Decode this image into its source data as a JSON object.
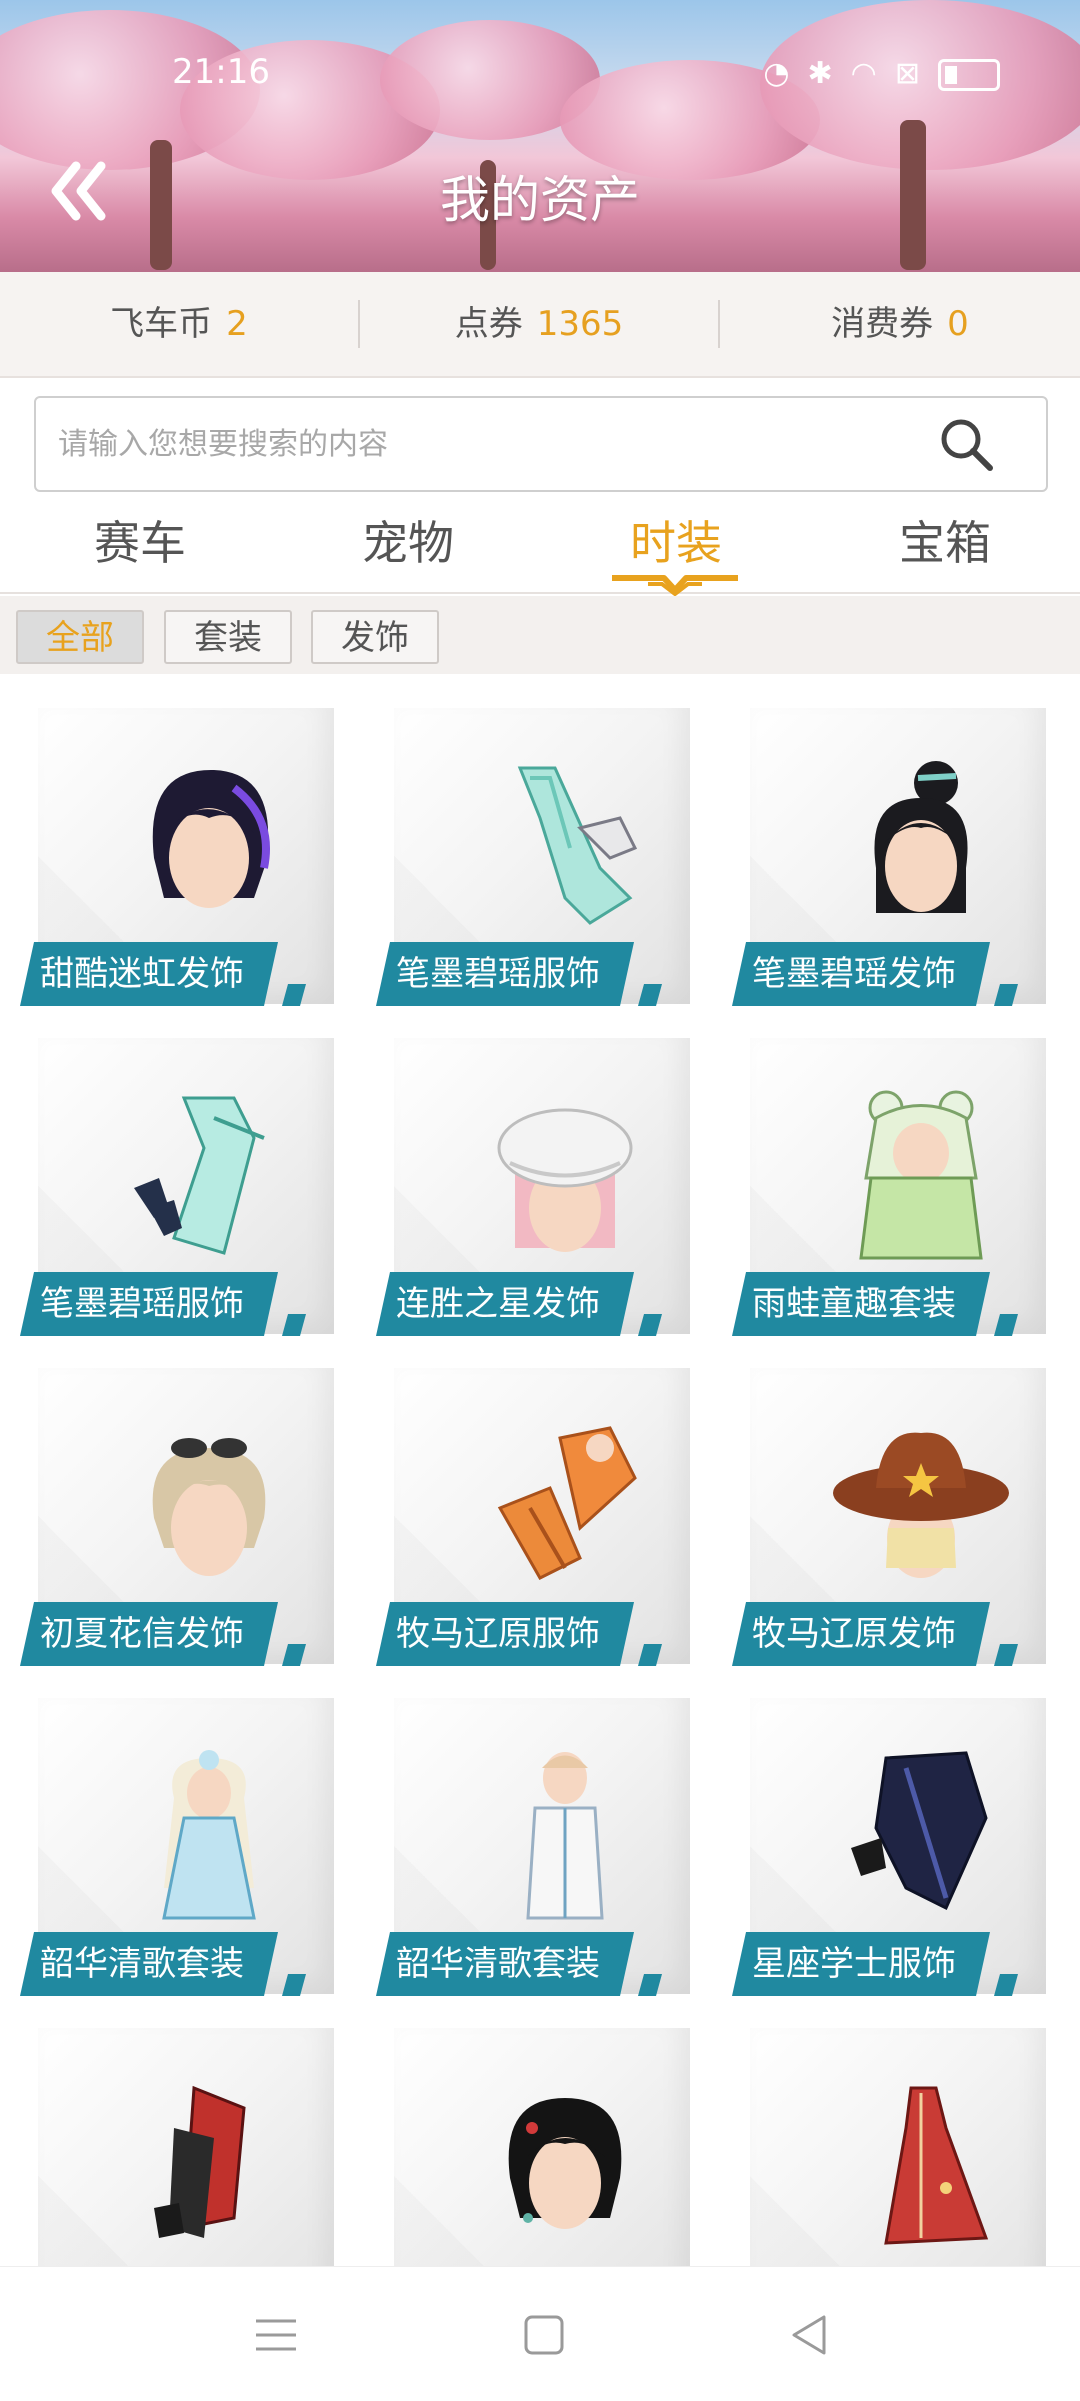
{
  "status_bar": {
    "time": "21:16"
  },
  "header": {
    "title": "我的资产"
  },
  "balances": [
    {
      "label": "飞车币",
      "value": "2"
    },
    {
      "label": "点券",
      "value": "1365"
    },
    {
      "label": "消费券",
      "value": "0"
    }
  ],
  "search": {
    "placeholder": "请输入您想要搜索的内容"
  },
  "tabs": [
    {
      "label": "赛车"
    },
    {
      "label": "宠物"
    },
    {
      "label": "时装",
      "active": true
    },
    {
      "label": "宝箱"
    }
  ],
  "filters": [
    {
      "label": "全部",
      "active": true
    },
    {
      "label": "套装"
    },
    {
      "label": "发饰"
    }
  ],
  "items": [
    {
      "name": "甜酷迷虹发饰",
      "icon": "purple-hair-icon"
    },
    {
      "name": "笔墨碧瑶服饰",
      "icon": "cyan-gown-icon"
    },
    {
      "name": "笔墨碧瑶发饰",
      "icon": "black-updo-hair-icon"
    },
    {
      "name": "笔墨碧瑶服饰",
      "icon": "cyan-dress-boots-icon"
    },
    {
      "name": "连胜之星发饰",
      "icon": "white-beret-icon"
    },
    {
      "name": "雨蛙童趣套装",
      "icon": "frog-raincoat-icon"
    },
    {
      "name": "初夏花信发饰",
      "icon": "sunglasses-hair-icon"
    },
    {
      "name": "牧马辽原服饰",
      "icon": "orange-outfit-icon"
    },
    {
      "name": "牧马辽原发饰",
      "icon": "cowboy-hat-icon"
    },
    {
      "name": "韶华清歌套装",
      "icon": "princess-figure-icon"
    },
    {
      "name": "韶华清歌套装",
      "icon": "white-suit-figure-icon"
    },
    {
      "name": "星座学士服饰",
      "icon": "dark-coat-icon"
    },
    {
      "name": "",
      "icon": "red-black-outfit-icon"
    },
    {
      "name": "",
      "icon": "black-hair-earrings-icon"
    },
    {
      "name": "",
      "icon": "red-dress-icon"
    }
  ],
  "colors": {
    "accent": "#e8a21e",
    "label_teal": "#2089a0"
  }
}
